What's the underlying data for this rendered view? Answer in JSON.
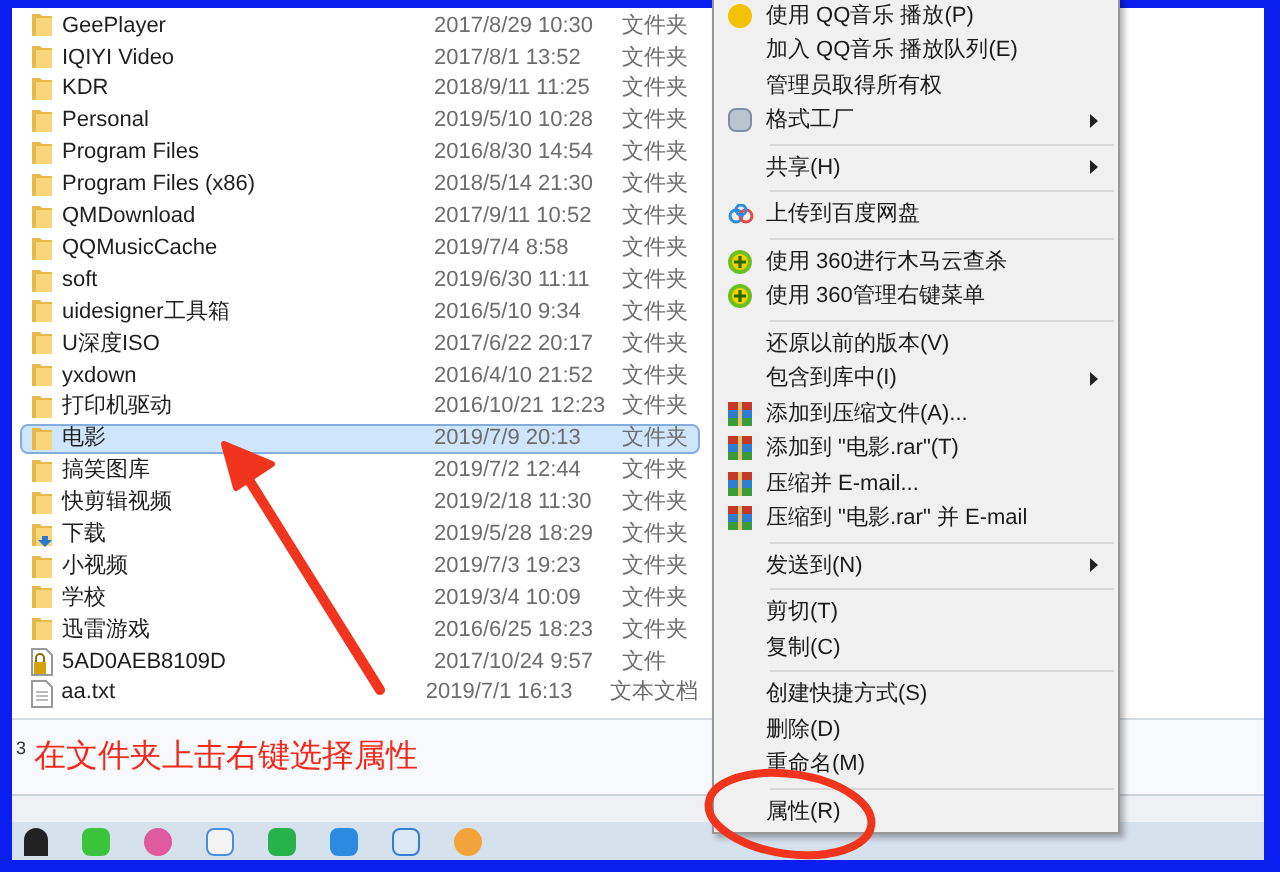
{
  "file_list": {
    "rows": [
      {
        "name": "GeePlayer",
        "date": "2017/8/29 10:30",
        "type": "文件夹",
        "kind": "folder",
        "selected": false
      },
      {
        "name": "IQIYI Video",
        "date": "2017/8/1 13:52",
        "type": "文件夹",
        "kind": "folder",
        "selected": false
      },
      {
        "name": "KDR",
        "date": "2018/9/11 11:25",
        "type": "文件夹",
        "kind": "folder",
        "selected": false
      },
      {
        "name": "Personal",
        "date": "2019/5/10 10:28",
        "type": "文件夹",
        "kind": "folder",
        "selected": false
      },
      {
        "name": "Program Files",
        "date": "2016/8/30 14:54",
        "type": "文件夹",
        "kind": "folder",
        "selected": false
      },
      {
        "name": "Program Files (x86)",
        "date": "2018/5/14 21:30",
        "type": "文件夹",
        "kind": "folder",
        "selected": false
      },
      {
        "name": "QMDownload",
        "date": "2017/9/11 10:52",
        "type": "文件夹",
        "kind": "folder",
        "selected": false
      },
      {
        "name": "QQMusicCache",
        "date": "2019/7/4 8:58",
        "type": "文件夹",
        "kind": "folder",
        "selected": false
      },
      {
        "name": "soft",
        "date": "2019/6/30 11:11",
        "type": "文件夹",
        "kind": "folder",
        "selected": false
      },
      {
        "name": "uidesigner工具箱",
        "date": "2016/5/10 9:34",
        "type": "文件夹",
        "kind": "folder",
        "selected": false
      },
      {
        "name": "U深度ISO",
        "date": "2017/6/22 20:17",
        "type": "文件夹",
        "kind": "folder",
        "selected": false
      },
      {
        "name": "yxdown",
        "date": "2016/4/10 21:52",
        "type": "文件夹",
        "kind": "folder",
        "selected": false
      },
      {
        "name": "打印机驱动",
        "date": "2016/10/21 12:23",
        "type": "文件夹",
        "kind": "folder",
        "selected": false
      },
      {
        "name": "电影",
        "date": "2019/7/9 20:13",
        "type": "文件夹",
        "kind": "folder",
        "selected": true
      },
      {
        "name": "搞笑图库",
        "date": "2019/7/2 12:44",
        "type": "文件夹",
        "kind": "folder",
        "selected": false
      },
      {
        "name": "快剪辑视频",
        "date": "2019/2/18 11:30",
        "type": "文件夹",
        "kind": "folder",
        "selected": false
      },
      {
        "name": "下载",
        "date": "2019/5/28 18:29",
        "type": "文件夹",
        "kind": "download",
        "selected": false
      },
      {
        "name": "小视频",
        "date": "2019/7/3 19:23",
        "type": "文件夹",
        "kind": "folder",
        "selected": false
      },
      {
        "name": "学校",
        "date": "2019/3/4 10:09",
        "type": "文件夹",
        "kind": "folder",
        "selected": false
      },
      {
        "name": "迅雷游戏",
        "date": "2016/6/25 18:23",
        "type": "文件夹",
        "kind": "folder",
        "selected": false
      },
      {
        "name": "5AD0AEB8109D",
        "date": "2017/10/24 9:57",
        "type": "文件",
        "kind": "locked",
        "selected": false
      },
      {
        "name": "aa.txt",
        "date": "2019/7/1 16:13",
        "type": "文本文档",
        "kind": "text",
        "selected": false
      }
    ]
  },
  "detail_pane": {
    "count_fragment": "3"
  },
  "annotation": {
    "text": "在文件夹上击右键选择属性"
  },
  "context_menu": {
    "items": [
      {
        "kind": "qq",
        "label": "使用 QQ音乐 播放(P)",
        "submenu": false
      },
      {
        "kind": "plain",
        "label": "加入 QQ音乐 播放队列(E)",
        "submenu": false
      },
      {
        "kind": "plain",
        "label": "管理员取得所有权",
        "submenu": false
      },
      {
        "kind": "format",
        "label": "格式工厂",
        "submenu": true
      },
      {
        "kind": "separator"
      },
      {
        "kind": "plain",
        "label": "共享(H)",
        "submenu": true
      },
      {
        "kind": "separator"
      },
      {
        "kind": "cloud",
        "label": "上传到百度网盘",
        "submenu": false
      },
      {
        "kind": "separator"
      },
      {
        "kind": "shield",
        "label": "使用 360进行木马云查杀",
        "submenu": false
      },
      {
        "kind": "shield",
        "label": "使用 360管理右键菜单",
        "submenu": false
      },
      {
        "kind": "separator"
      },
      {
        "kind": "plain",
        "label": "还原以前的版本(V)",
        "submenu": false
      },
      {
        "kind": "plain",
        "label": "包含到库中(I)",
        "submenu": true
      },
      {
        "kind": "archive",
        "label": "添加到压缩文件(A)...",
        "submenu": false
      },
      {
        "kind": "archive",
        "label": "添加到 \"电影.rar\"(T)",
        "submenu": false
      },
      {
        "kind": "archive",
        "label": "压缩并 E-mail...",
        "submenu": false
      },
      {
        "kind": "archive",
        "label": "压缩到 \"电影.rar\" 并 E-mail",
        "submenu": false
      },
      {
        "kind": "separator"
      },
      {
        "kind": "plain",
        "label": "发送到(N)",
        "submenu": true
      },
      {
        "kind": "separator"
      },
      {
        "kind": "plain",
        "label": "剪切(T)",
        "submenu": false
      },
      {
        "kind": "plain",
        "label": "复制(C)",
        "submenu": false
      },
      {
        "kind": "separator"
      },
      {
        "kind": "plain",
        "label": "创建快捷方式(S)",
        "submenu": false
      },
      {
        "kind": "plain",
        "label": "删除(D)",
        "submenu": false
      },
      {
        "kind": "plain",
        "label": "重命名(M)",
        "submenu": false
      },
      {
        "kind": "separator"
      },
      {
        "kind": "plain",
        "label": "属性(R)",
        "submenu": false
      }
    ]
  }
}
